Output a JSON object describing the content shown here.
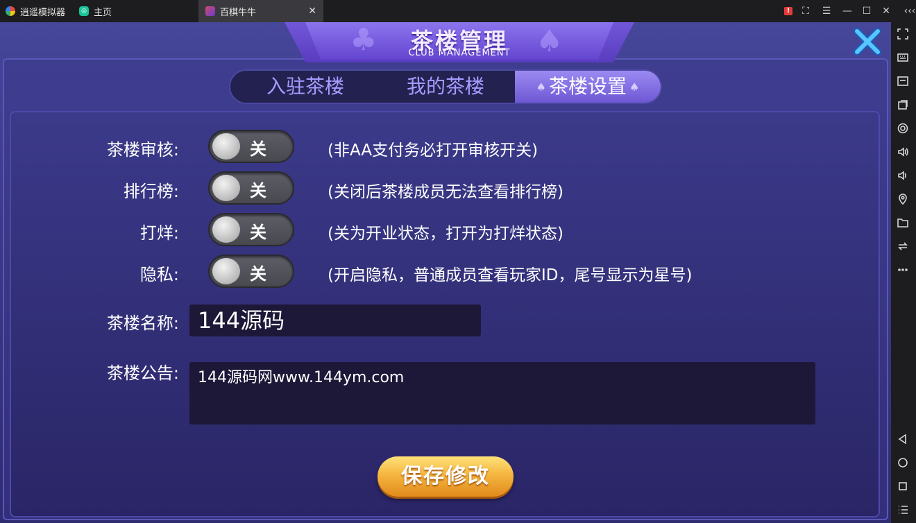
{
  "emulator": {
    "tabs": [
      {
        "label": "逍遥模拟器"
      },
      {
        "label": "主页"
      },
      {
        "label": "百棋牛牛"
      }
    ]
  },
  "header": {
    "title_cn": "茶楼管理",
    "title_en": "CLUB MANAGEMENT"
  },
  "tabs": [
    {
      "label": "入驻茶楼"
    },
    {
      "label": "我的茶楼"
    },
    {
      "label": "茶楼设置"
    }
  ],
  "settings": [
    {
      "label": "茶楼审核:",
      "state": "关",
      "desc": "(非AA支付务必打开审核开关)"
    },
    {
      "label": "排行榜:",
      "state": "关",
      "desc": "(关闭后茶楼成员无法查看排行榜)"
    },
    {
      "label": "打烊:",
      "state": "关",
      "desc": "(关为开业状态，打开为打烊状态)"
    },
    {
      "label": "隐私:",
      "state": "关",
      "desc": "(开启隐私，普通成员查看玩家ID，尾号显示为星号)"
    }
  ],
  "club_name": {
    "label": "茶楼名称:",
    "value": "144源码"
  },
  "club_notice": {
    "label": "茶楼公告:",
    "value": "144源码网www.144ym.com"
  },
  "save_button": "保存修改",
  "colors": {
    "accent": "#7158d8",
    "button": "#f5b640",
    "background": "#3c3a88"
  }
}
